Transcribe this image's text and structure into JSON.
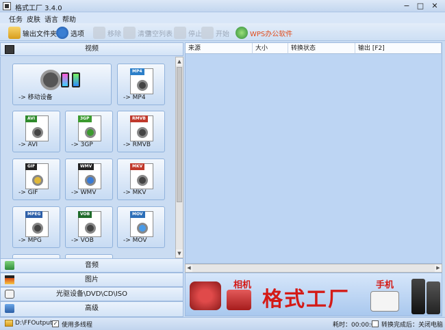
{
  "window": {
    "title": "格式工厂 3.4.0",
    "min": "−",
    "max": "□",
    "close": "✕"
  },
  "menu": [
    "任务",
    "皮肤",
    "语言",
    "帮助"
  ],
  "toolbar": {
    "output_folder": "输出文件夹",
    "options": "选项",
    "remove": "移除",
    "clear": "清空",
    "clear_list": "清空列表",
    "stop": "停止",
    "start": "开始",
    "wps": "WPS办公软件",
    "accent": "#e04a1a"
  },
  "categories": {
    "video": "视频",
    "audio": "音频",
    "picture": "图片",
    "rom": "光驱设备\\DVD\\CD\\ISO",
    "advanced": "高级"
  },
  "tiles": [
    {
      "label": "-> 移动设备",
      "tag": ""
    },
    {
      "label": "-> MP4",
      "tag": "MP4",
      "color": "#2d7fc8"
    },
    {
      "label": "-> AVI",
      "tag": "AVI",
      "color": "#2f8a2c"
    },
    {
      "label": "-> 3GP",
      "tag": "3GP",
      "color": "#3c9a2f"
    },
    {
      "label": "-> RMVB",
      "tag": "RMVB",
      "color": "#c0392b"
    },
    {
      "label": "-> GIF",
      "tag": "GIF",
      "color": "#222222"
    },
    {
      "label": "-> WMV",
      "tag": "WMV",
      "color": "#222222"
    },
    {
      "label": "-> MKV",
      "tag": "MKV",
      "color": "#c0392b"
    },
    {
      "label": "-> MPG",
      "tag": "MPEG",
      "color": "#2d5fa8"
    },
    {
      "label": "-> VOB",
      "tag": "VOB",
      "color": "#1f6b2a"
    },
    {
      "label": "-> MOV",
      "tag": "MOV",
      "color": "#2d6fb8"
    }
  ],
  "columns": [
    "来源",
    "大小",
    "转换状态",
    "输出 [F2]"
  ],
  "banner": {
    "title": "格式工厂",
    "camera": "相机",
    "phone": "手机"
  },
  "status": {
    "path": "D:\\FFOutput",
    "multithread": "使用多线程",
    "elapsed": "耗时：00:00:00",
    "after": "转换完成后：关闭电脑"
  }
}
